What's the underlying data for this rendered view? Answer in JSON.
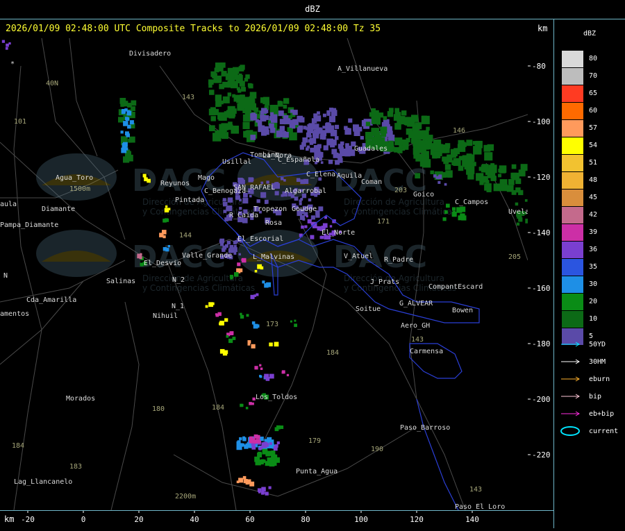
{
  "top_title": "dBZ",
  "header": {
    "title": "2026/01/09 02:48:00 UTC Composite Tracks to 2026/01/09 02:48:00 Tz 35",
    "km_label": "km"
  },
  "axes": {
    "km_label": "km",
    "x_ticks": [
      "-20",
      "0",
      "20",
      "40",
      "60",
      "80",
      "100",
      "120",
      "140"
    ],
    "y_ticks": [
      "-80",
      "-100",
      "-120",
      "-140",
      "-160",
      "-180",
      "-200",
      "-220"
    ]
  },
  "legend": {
    "title": "dBZ",
    "colors": [
      {
        "label": "80",
        "color": "#d9d9d9"
      },
      {
        "label": "70",
        "color": "#bdbdbd"
      },
      {
        "label": "65",
        "color": "#ff3b22"
      },
      {
        "label": "60",
        "color": "#ff6a00"
      },
      {
        "label": "57",
        "color": "#ff9a5c"
      },
      {
        "label": "54",
        "color": "#ffff00"
      },
      {
        "label": "51",
        "color": "#f2c230"
      },
      {
        "label": "48",
        "color": "#f0b233"
      },
      {
        "label": "45",
        "color": "#d98e3c"
      },
      {
        "label": "42",
        "color": "#c46a8c"
      },
      {
        "label": "39",
        "color": "#cc2fa6"
      },
      {
        "label": "36",
        "color": "#7a3fd0"
      },
      {
        "label": "35",
        "color": "#2b55e0"
      },
      {
        "label": "30",
        "color": "#1e8fe6"
      },
      {
        "label": "20",
        "color": "#0a8c16"
      },
      {
        "label": "10",
        "color": "#0c6a16"
      },
      {
        "label": "5",
        "color": "#5a4aa8"
      }
    ],
    "tracks": [
      {
        "label": "50YD",
        "color": "#00e5ff"
      },
      {
        "label": "30HM",
        "color": "#ffffff"
      },
      {
        "label": "eburn",
        "color": "#ffb22e"
      },
      {
        "label": "bip",
        "color": "#ffc8d8"
      },
      {
        "label": "eb+bip",
        "color": "#ff2ee0"
      },
      {
        "label": "current",
        "color": "#00e5ff"
      }
    ]
  },
  "places": [
    {
      "name": "Divisadero"
    },
    {
      "name": "A_Villanueva"
    },
    {
      "name": "40N"
    },
    {
      "name": "101"
    },
    {
      "name": "143"
    },
    {
      "name": "Tombino"
    },
    {
      "name": "Usillal"
    },
    {
      "name": "La_Nora"
    },
    {
      "name": "C_Española"
    },
    {
      "name": "Guadales"
    },
    {
      "name": "146"
    },
    {
      "name": "Agua_Toro"
    },
    {
      "name": "Reyunos"
    },
    {
      "name": "Mago"
    },
    {
      "name": "C_Benogaza"
    },
    {
      "name": "SAN_RAFAEL"
    },
    {
      "name": "Algarrobal"
    },
    {
      "name": "C_Elena"
    },
    {
      "name": "Aquila"
    },
    {
      "name": "Coman"
    },
    {
      "name": "203"
    },
    {
      "name": "Goico"
    },
    {
      "name": "C_Campos"
    },
    {
      "name": "Uvela"
    },
    {
      "name": "aula"
    },
    {
      "name": "Pampa_Diamante"
    },
    {
      "name": "Pintada"
    },
    {
      "name": "Tropezon"
    },
    {
      "name": "Goudge"
    },
    {
      "name": "R_Caida"
    },
    {
      "name": "Rosa"
    },
    {
      "name": "171"
    },
    {
      "name": "144"
    },
    {
      "name": "El_Escorial"
    },
    {
      "name": "El_Norte"
    },
    {
      "name": "Valle_Grande"
    },
    {
      "name": "L_Malvinas"
    },
    {
      "name": "V_Atuel"
    },
    {
      "name": "R_Padre"
    },
    {
      "name": "El_Desvio"
    },
    {
      "name": "205"
    },
    {
      "name": "Salinas"
    },
    {
      "name": "N_2"
    },
    {
      "name": "J_Prats"
    },
    {
      "name": "CompantEscard"
    },
    {
      "name": "Cda_Amarilla"
    },
    {
      "name": "G_ALVEAR"
    },
    {
      "name": "Bowen"
    },
    {
      "name": "amentos"
    },
    {
      "name": "N_1"
    },
    {
      "name": "Nihuil"
    },
    {
      "name": "Soitue"
    },
    {
      "name": "Aero_GH"
    },
    {
      "name": "173"
    },
    {
      "name": "143"
    },
    {
      "name": "184"
    },
    {
      "name": "Carmensa"
    },
    {
      "name": "Morados"
    },
    {
      "name": "180"
    },
    {
      "name": "184"
    },
    {
      "name": "Los_Toldos"
    },
    {
      "name": "184"
    },
    {
      "name": "Paso_Barroso"
    },
    {
      "name": "179"
    },
    {
      "name": "190"
    },
    {
      "name": "183"
    },
    {
      "name": "Punta_Agua"
    },
    {
      "name": "Lag_Llancanelo"
    },
    {
      "name": "2200m"
    },
    {
      "name": "143"
    },
    {
      "name": "Paso_El_Loro"
    },
    {
      "name": "1500m"
    },
    {
      "name": "Diamante"
    },
    {
      "name": "N"
    },
    {
      "name": "*"
    }
  ],
  "watermark": {
    "logo": "DACC",
    "line1": "Dirección de Agricultura",
    "line2": "y Contingencias Climáticas"
  }
}
